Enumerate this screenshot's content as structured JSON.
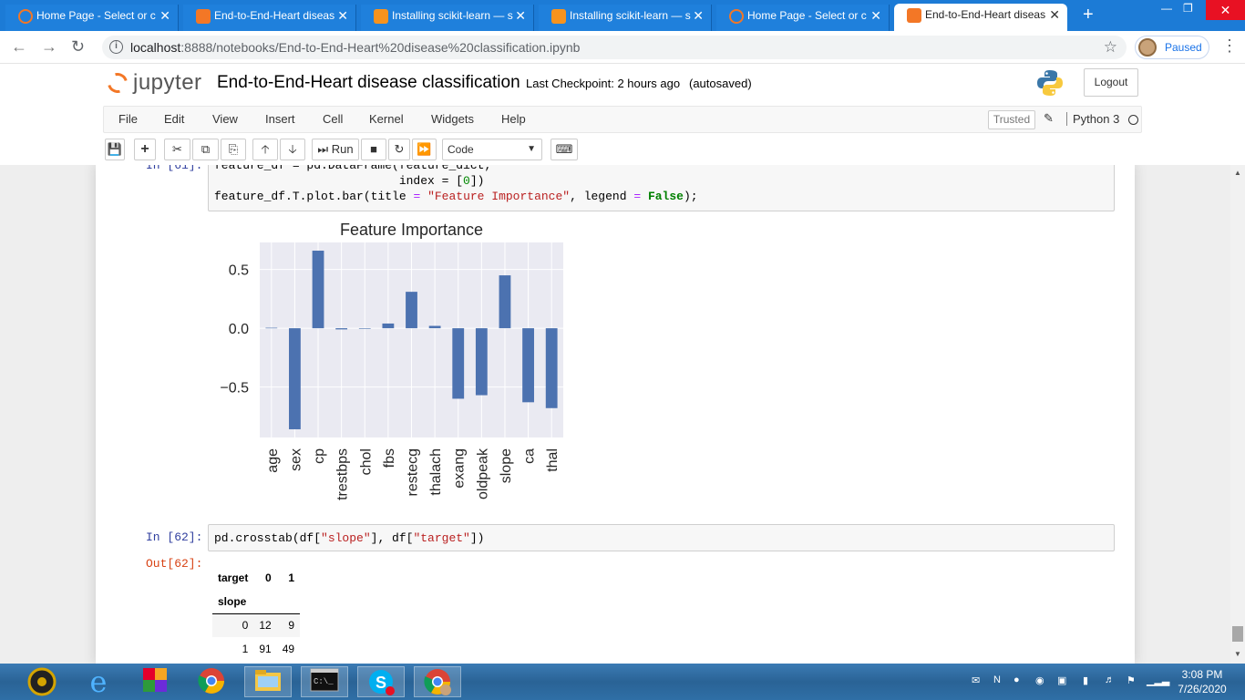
{
  "browser": {
    "tabs": [
      {
        "title": "Home Page - Select or c",
        "active": false
      },
      {
        "title": "End-to-End-Heart diseas",
        "active": false
      },
      {
        "title": "Installing scikit-learn — s",
        "active": false
      },
      {
        "title": "Installing scikit-learn — s",
        "active": false
      },
      {
        "title": "Home Page - Select or c",
        "active": false
      },
      {
        "title": "End-to-End-Heart diseas",
        "active": true
      }
    ],
    "new_tab_icon": "plus-icon",
    "url_host": "localhost",
    "url_rest": ":8888/notebooks/End-to-End-Heart%20disease%20classification.ipynb",
    "profile_status": "Paused"
  },
  "jupyter": {
    "logo_text": "jupyter",
    "notebook_title": "End-to-End-Heart disease classification",
    "checkpoint": "Last Checkpoint: 2 hours ago",
    "autosave": "(autosaved)",
    "logout_label": "Logout",
    "menu": [
      "File",
      "Edit",
      "View",
      "Insert",
      "Cell",
      "Kernel",
      "Widgets",
      "Help"
    ],
    "trusted_label": "Trusted",
    "kernel_name": "Python 3",
    "toolbar": {
      "run_label": "Run",
      "cell_type": "Code"
    }
  },
  "cells": {
    "cell61": {
      "prompt": "In [61]:",
      "lines": [
        "feature_df = pd.DataFrame(feature_dict,",
        "                          index = [0])",
        "feature_df.T.plot.bar(title = \"Feature Importance\", legend = False);"
      ]
    },
    "cell62": {
      "prompt": "In [62]:",
      "out_prompt": "Out[62]:",
      "code": "pd.crosstab(df[\"slope\"], df[\"target\"])",
      "table": {
        "columns_label": "target",
        "columns": [
          "0",
          "1"
        ],
        "index_label": "slope",
        "rows": [
          {
            "index": "0",
            "values": [
              "12",
              "9"
            ]
          },
          {
            "index": "1",
            "values": [
              "91",
              "49"
            ]
          }
        ]
      }
    }
  },
  "chart_data": {
    "type": "bar",
    "title": "Feature Importance",
    "categories": [
      "age",
      "sex",
      "cp",
      "trestbps",
      "chol",
      "fbs",
      "restecg",
      "thalach",
      "exang",
      "oldpeak",
      "slope",
      "ca",
      "thal"
    ],
    "values": [
      0.004,
      -0.86,
      0.66,
      -0.01,
      -0.002,
      0.04,
      0.31,
      0.02,
      -0.6,
      -0.57,
      0.45,
      -0.63,
      -0.68
    ],
    "ylim": [
      -0.93,
      0.73
    ],
    "yticks": [
      0.5,
      0.0,
      -0.5
    ],
    "ytick_labels": [
      "0.5",
      "0.0",
      "−0.5"
    ],
    "grid": true,
    "bar_color": "#4c72b0",
    "background": "#eaeaf2"
  },
  "taskbar": {
    "time": "3:08 PM",
    "date": "7/26/2020",
    "apps": [
      "media-player-icon",
      "internet-explorer-icon",
      "photos-icon",
      "chrome-icon",
      "file-explorer-icon",
      "command-prompt-icon",
      "skype-icon",
      "chrome-user-icon"
    ]
  }
}
